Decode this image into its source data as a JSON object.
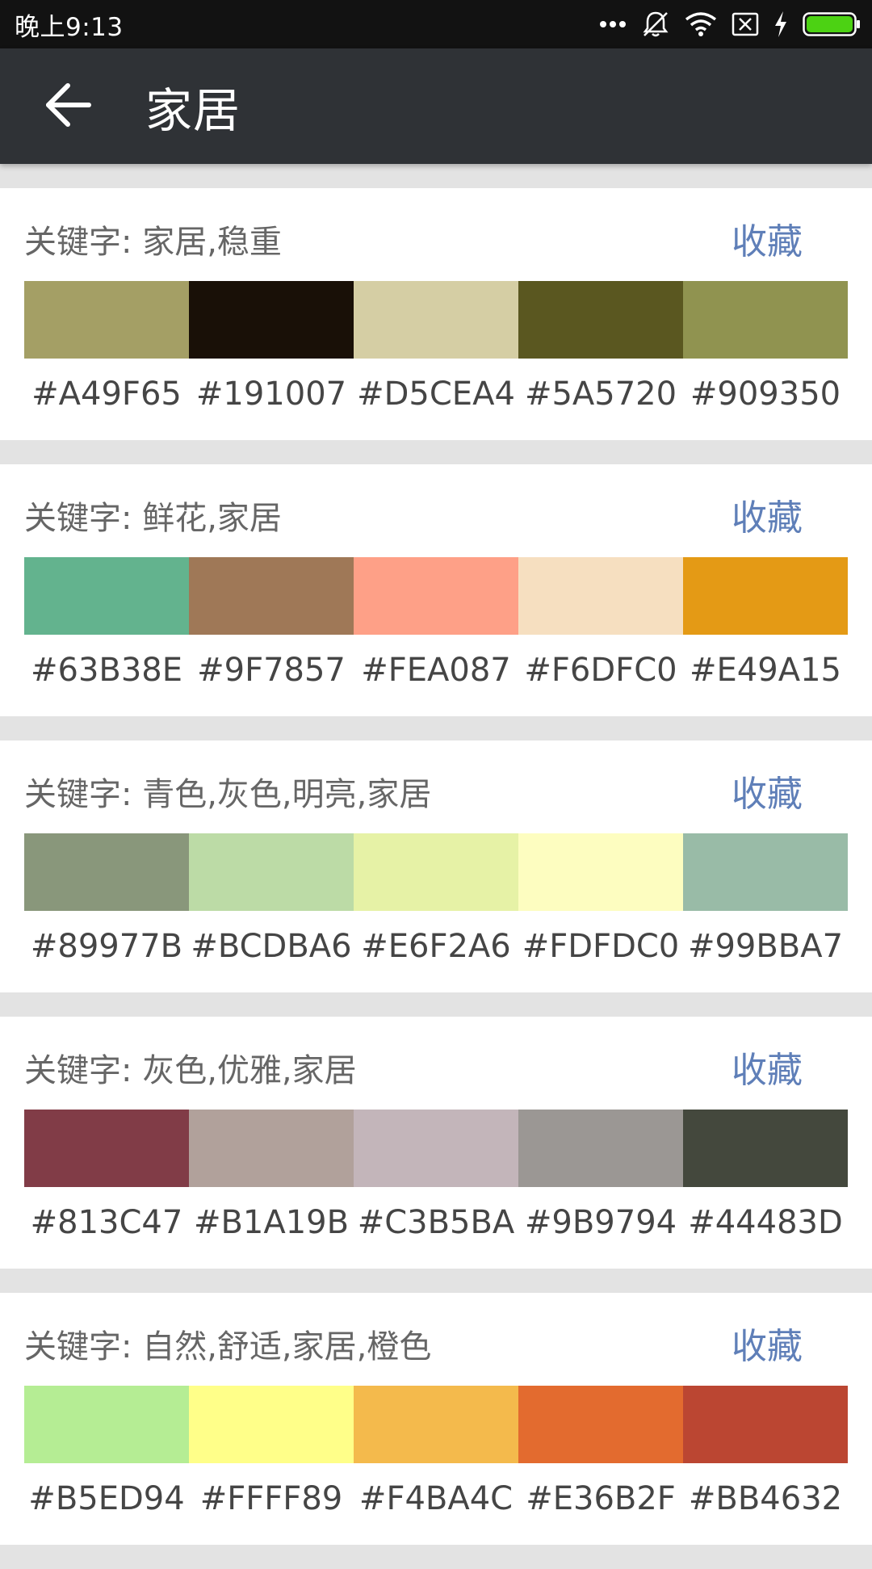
{
  "status_bar": {
    "time": "晚上9:13",
    "icons": [
      "more-dots-icon",
      "vibrate-off-icon",
      "wifi-icon",
      "sim-card-x-icon",
      "charging-bolt-icon",
      "battery-icon"
    ],
    "battery_color": "#4cd213"
  },
  "app_bar": {
    "title": "家居",
    "back_icon": "arrow-left-icon",
    "background": "#2f3236"
  },
  "palettes": [
    {
      "keywords": "关键字: 家居,稳重",
      "favorite_label": "收藏",
      "colors": [
        "#A49F65",
        "#191007",
        "#D5CEA4",
        "#5A5720",
        "#909350"
      ]
    },
    {
      "keywords": "关键字: 鲜花,家居",
      "favorite_label": "收藏",
      "colors": [
        "#63B38E",
        "#9F7857",
        "#FEA087",
        "#F6DFC0",
        "#E49A15"
      ]
    },
    {
      "keywords": "关键字: 青色,灰色,明亮,家居",
      "favorite_label": "收藏",
      "colors": [
        "#89977B",
        "#BCDBA6",
        "#E6F2A6",
        "#FDFDC0",
        "#99BBA7"
      ]
    },
    {
      "keywords": "关键字: 灰色,优雅,家居",
      "favorite_label": "收藏",
      "colors": [
        "#813C47",
        "#B1A19B",
        "#C3B5BA",
        "#9B9794",
        "#44483D"
      ]
    },
    {
      "keywords": "关键字: 自然,舒适,家居,橙色",
      "favorite_label": "收藏",
      "colors": [
        "#B5ED94",
        "#FFFF89",
        "#F4BA4C",
        "#E36B2F",
        "#BB4632"
      ]
    }
  ]
}
